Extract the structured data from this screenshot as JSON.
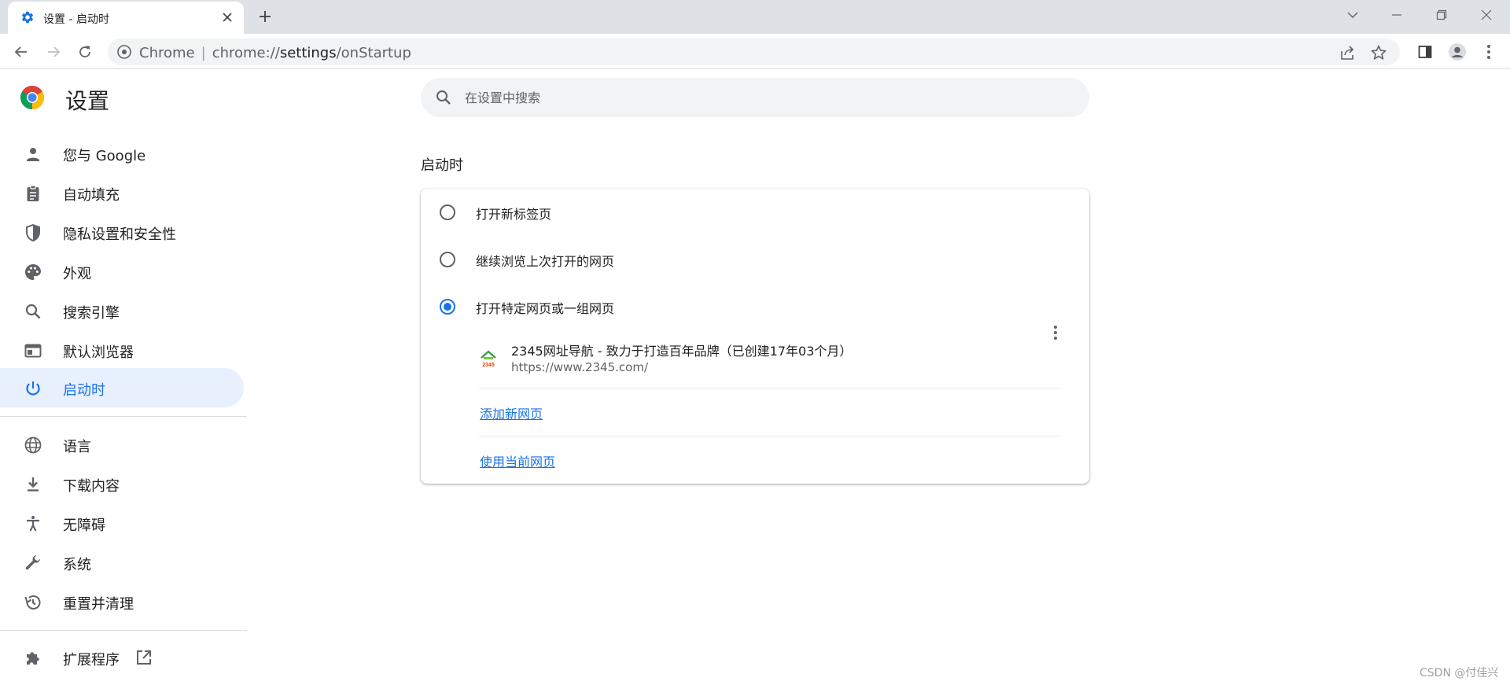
{
  "window": {
    "tab_title": "设置 - 启动时",
    "tab_icon": "gear-icon"
  },
  "toolbar": {
    "omnibox": {
      "scheme_label": "Chrome",
      "separator": "|",
      "url_prefix": "chrome://",
      "url_host": "settings",
      "url_path": "/onStartup"
    }
  },
  "sidebar": {
    "title": "设置",
    "items": [
      {
        "label": "您与 Google",
        "icon": "person-icon",
        "active": false
      },
      {
        "label": "自动填充",
        "icon": "clipboard-icon",
        "active": false
      },
      {
        "label": "隐私设置和安全性",
        "icon": "shield-icon",
        "active": false
      },
      {
        "label": "外观",
        "icon": "palette-icon",
        "active": false
      },
      {
        "label": "搜索引擎",
        "icon": "search-icon",
        "active": false
      },
      {
        "label": "默认浏览器",
        "icon": "browser-window-icon",
        "active": false
      },
      {
        "label": "启动时",
        "icon": "power-icon",
        "active": true
      }
    ],
    "advanced_items": [
      {
        "label": "语言",
        "icon": "globe-icon"
      },
      {
        "label": "下载内容",
        "icon": "download-icon"
      },
      {
        "label": "无障碍",
        "icon": "accessibility-icon"
      },
      {
        "label": "系统",
        "icon": "wrench-icon"
      },
      {
        "label": "重置并清理",
        "icon": "history-icon"
      }
    ],
    "extensions": {
      "label": "扩展程序",
      "icon": "puzzle-icon",
      "external_icon": "open-in-new-icon"
    }
  },
  "search": {
    "placeholder": "在设置中搜索"
  },
  "main": {
    "section_title": "启动时",
    "options": [
      {
        "label": "打开新标签页",
        "checked": false
      },
      {
        "label": "继续浏览上次打开的网页",
        "checked": false
      },
      {
        "label": "打开特定网页或一组网页",
        "checked": true
      }
    ],
    "startup_pages": [
      {
        "title": "2345网址导航 - 致力于打造百年品牌（已创建17年03个月）",
        "url": "https://www.2345.com/"
      }
    ],
    "add_page_link": "添加新网页",
    "use_current_link": "使用当前网页"
  },
  "watermark": "CSDN @付佳兴",
  "colors": {
    "accent": "#1a73e8",
    "active_bg": "#e8f0fe",
    "tabstrip_bg": "#dee1e6",
    "omnibox_bg": "#f1f3f4"
  }
}
